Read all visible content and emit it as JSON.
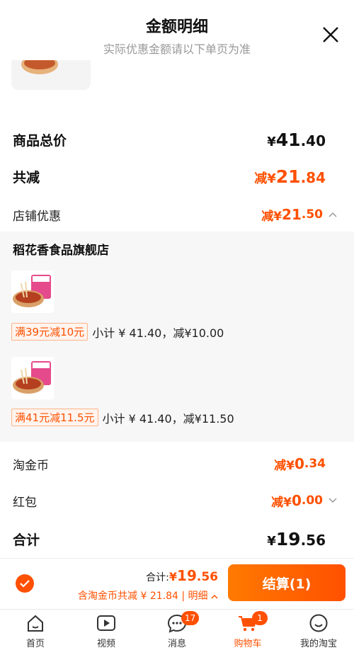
{
  "header": {
    "title": "金额明细",
    "subtitle": "实际优惠金额请以下单页为准"
  },
  "summary": {
    "total_label": "商品总价",
    "total_currency": "¥",
    "total_int": "41",
    "total_dec": ".40",
    "reduce_label": "共减",
    "reduce_prefix": "减¥",
    "reduce_int": "21",
    "reduce_dec": ".84",
    "shop_discount_label": "店铺优惠",
    "shop_discount_prefix": "减¥",
    "shop_discount_int": "21",
    "shop_discount_dec": ".50"
  },
  "shop": {
    "name": "稻花香食品旗舰店",
    "items": [
      {
        "promo_tag": "满39元减10元",
        "subtotal": "小计 ¥ 41.40，减¥10.00"
      },
      {
        "promo_tag": "满41元减11.5元",
        "subtotal": "小计 ¥ 41.40，减¥11.50"
      }
    ]
  },
  "extras": {
    "coin_label": "淘金币",
    "coin_prefix": "减¥",
    "coin_int": "0",
    "coin_dec": ".34",
    "redpacket_label": "红包",
    "redpacket_prefix": "减¥",
    "redpacket_int": "0",
    "redpacket_dec": ".00",
    "sum_label": "合计",
    "sum_currency": "¥",
    "sum_int": "19",
    "sum_dec": ".56"
  },
  "bottom_bar": {
    "sum_label": "合计:",
    "sum_currency": "¥",
    "sum_int": "19",
    "sum_dec": ".56",
    "detail_text": "含淘金币共减 ¥ 21.84 | 明细",
    "checkout_label": "结算(1)"
  },
  "tabbar": {
    "tabs": [
      {
        "label": "首页"
      },
      {
        "label": "视频"
      },
      {
        "label": "消息",
        "badge": "17"
      },
      {
        "label": "购物车",
        "badge": "1"
      },
      {
        "label": "我的淘宝"
      }
    ]
  },
  "colors": {
    "accent": "#ff5000",
    "panel_bg": "#f7f7f7"
  }
}
